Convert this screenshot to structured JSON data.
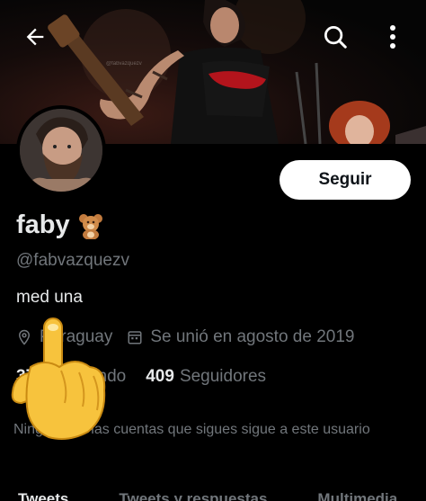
{
  "banner": {
    "watermark": "@fabvazquezv"
  },
  "top_bar": {
    "back_icon": "arrow-left-icon",
    "search_icon": "search-icon",
    "more_icon": "more-vertical-icon"
  },
  "profile": {
    "name": "faby",
    "name_emoji": "teddy-bear-emoji",
    "handle": "@fabvazquezv",
    "bio": "med una",
    "location": "Paraguay",
    "joined": "Se unió en agosto de 2019",
    "following_count": "370",
    "following_label": "Siguiendo",
    "followers_count": "409",
    "followers_label": "Seguidores",
    "followed_note": "Ninguna de las cuentas que sigues sigue a este usuario"
  },
  "actions": {
    "follow_label": "Seguir"
  },
  "tabs": [
    {
      "label": "Tweets",
      "active": true
    },
    {
      "label": "Tweets y respuestas",
      "active": false
    },
    {
      "label": "Multimedia",
      "active": false
    }
  ],
  "overlay": {
    "icon": "pointing-up-hand-emoji"
  },
  "colors": {
    "background": "#000000",
    "text": "#e7e9ea",
    "secondary": "#71767b",
    "button_bg": "#ffffff",
    "button_text": "#0f1419"
  }
}
